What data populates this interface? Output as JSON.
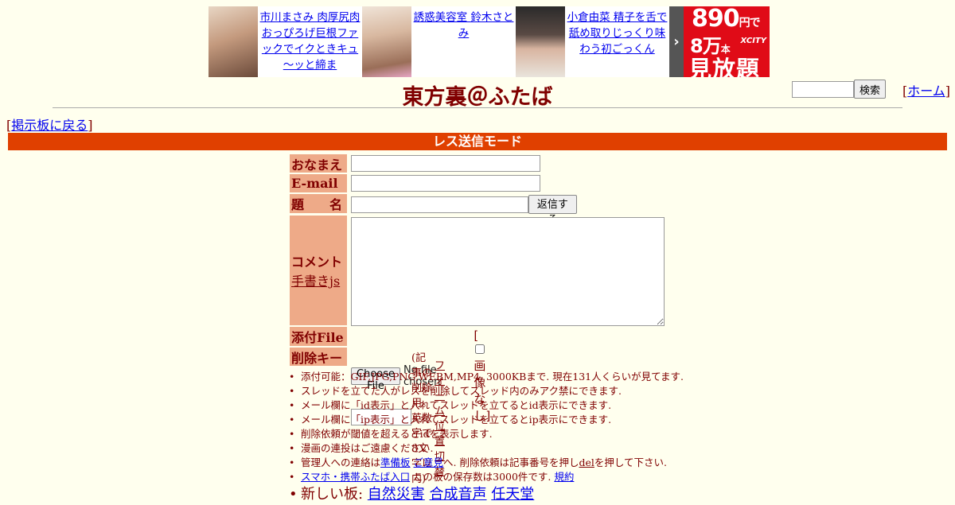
{
  "ads": [
    {
      "thumb_tag": "",
      "text": "市川まさみ 肉厚尻肉おっぴろげ巨根ファックでイクときキュ～ッと締ま"
    },
    {
      "thumb_tag": "",
      "text": "誘惑美容室 鈴木さとみ"
    },
    {
      "thumb_tag": "",
      "text": "小倉由菜 精子を舌で舐め取りじっくり味わう初ごっくん"
    }
  ],
  "banner": {
    "line1": "890",
    "line1_unit": "円で",
    "line2": "8万",
    "line2_unit": "本",
    "brand": "XCITY",
    "line3": "見放題"
  },
  "header": {
    "title": "東方裏＠ふたば",
    "search_button": "検索",
    "home_bracket_open": "[",
    "home_label": "ホーム",
    "home_bracket_close": "]",
    "back_open": "[",
    "back_label": "掲示板に戻る",
    "back_close": "]"
  },
  "mode_bar": "レス送信モード",
  "form": {
    "name_label": "おなまえ",
    "email_label": "E-mail",
    "subject_label": "題　　名",
    "submit_label": "返信する",
    "comment_label": "コメント",
    "handwrite_link": "手書きjs",
    "file_label": "添付File",
    "file_button": "Choose File",
    "file_status": "No file chosen",
    "noimage_open": "[",
    "noimage_label": "画像なし",
    "noimage_close": "]",
    "delkey_label": "削除キー",
    "delkey_note": "(記事の削除用。英数字で8文字以内)",
    "form_toggle": "フォーム位置切替"
  },
  "notes": [
    {
      "text": "添付可能：GIF,JPG,PNG,WEBM,MP4. 3000KBまで. 現在131人くらいが見てます."
    },
    {
      "text": "スレッドを立てた人がレスを削除してスレッド内のみアク禁にできます."
    },
    {
      "text": "メール欄に「id表示」と入れてスレッドを立てるとid表示にできます."
    },
    {
      "text": "メール欄に「ip表示」と入れてスレッドを立てるとip表示にできます."
    },
    {
      "text": "削除依頼が閾値を超えるとidを表示します."
    },
    {
      "text": "漫画の連投はご遠慮ください."
    }
  ],
  "note_contact": {
    "pre": "管理人への連絡は",
    "link1": "準備板",
    "link2": "ご意見",
    "mid": "へ. 削除依頼は記事番号を押し",
    "link3": "del",
    "post": "を押して下さい."
  },
  "note_mobile": {
    "link": "スマホ・携帯ふたば入口",
    "mid": " この板の保存数は3000件です. ",
    "link2": "規約"
  },
  "note_newboards": {
    "pre": "新しい板: ",
    "b1": "自然災害",
    "b2": "合成音声",
    "b3": "任天堂"
  }
}
